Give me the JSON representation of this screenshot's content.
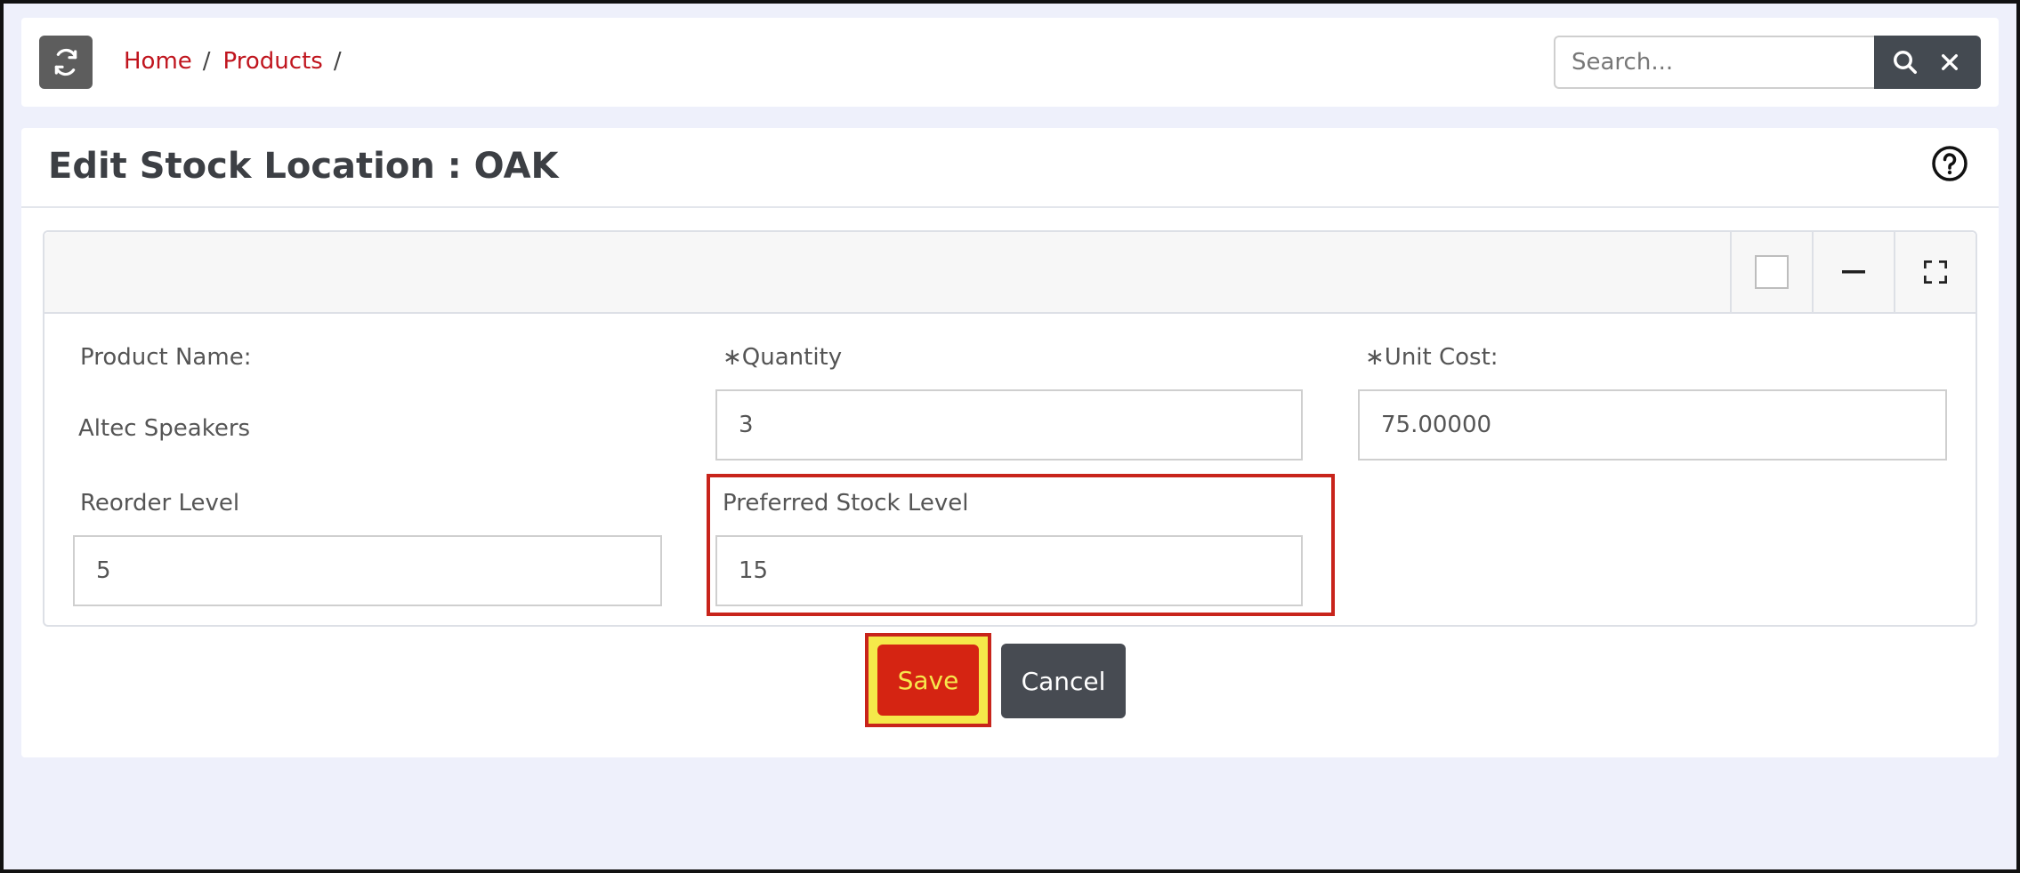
{
  "breadcrumb": {
    "home": "Home",
    "products": "Products",
    "separator": "/"
  },
  "search": {
    "placeholder": "Search...",
    "value": ""
  },
  "page": {
    "title": "Edit Stock Location : OAK"
  },
  "form": {
    "product_name_label": "Product Name:",
    "product_name_value": "Altec Speakers",
    "quantity_label": "∗Quantity",
    "quantity_value": "3",
    "unit_cost_label": "∗Unit Cost:",
    "unit_cost_value": "75.00000",
    "reorder_level_label": "Reorder Level",
    "reorder_level_value": "5",
    "preferred_stock_label": "Preferred Stock Level",
    "preferred_stock_value": "15"
  },
  "actions": {
    "save_label": "Save",
    "cancel_label": "Cancel"
  },
  "icons": {
    "refresh": "refresh-icon",
    "search": "search-icon",
    "close": "close-icon",
    "help": "help-icon",
    "minimize": "minus-icon",
    "fullscreen": "expand-icon"
  },
  "colors": {
    "link": "#c0151e",
    "save_button": "#d52412",
    "save_text": "#f7e74c",
    "highlight_fill": "#f5e94a",
    "highlight_border": "#c8241b",
    "dark_button": "#474b52",
    "background": "#eef0fb"
  }
}
